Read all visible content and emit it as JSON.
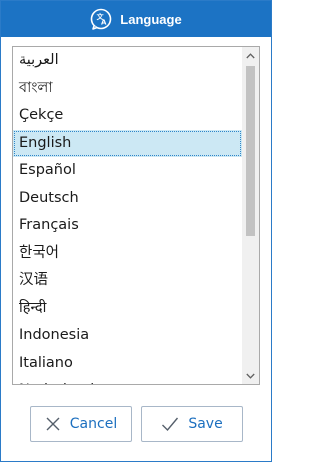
{
  "window": {
    "title": "Language",
    "title_icon": "language-icon",
    "accent": "#1c73c4"
  },
  "languages": [
    "العربية",
    "বাংলা",
    "Çekçe",
    "English",
    "Español",
    "Deutsch",
    "Français",
    "한국어",
    "汉语",
    "हिन्दी",
    "Indonesia",
    "Italiano",
    "Nederlands"
  ],
  "selected_language": "English",
  "buttons": {
    "cancel_label": "Cancel",
    "cancel_icon": "close-icon",
    "save_label": "Save",
    "save_icon": "checkmark-icon"
  }
}
